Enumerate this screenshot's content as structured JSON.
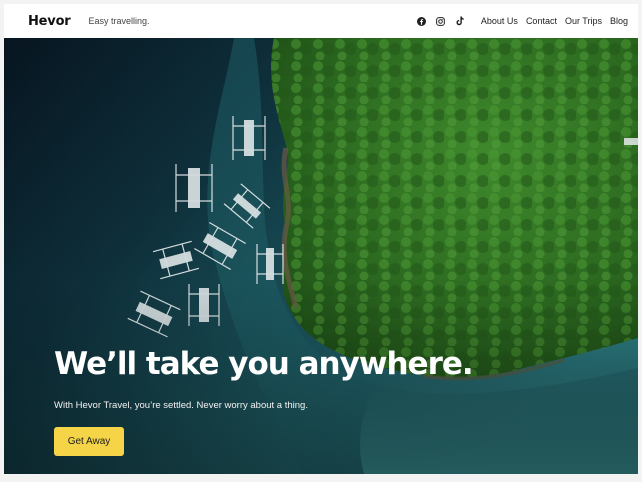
{
  "header": {
    "logo": "Hevor",
    "tagline": "Easy travelling.",
    "socials": [
      {
        "icon": "facebook-icon"
      },
      {
        "icon": "instagram-icon"
      },
      {
        "icon": "tiktok-icon"
      }
    ],
    "nav": [
      "About Us",
      "Contact",
      "Our Trips",
      "Blog"
    ]
  },
  "hero": {
    "title": "We’ll take you anywhere.",
    "subtitle": "With Hevor Travel, you’re settled. Never worry about a thing.",
    "cta_label": "Get Away"
  },
  "colors": {
    "accent": "#f5d547",
    "text_dark": "#111111",
    "sea_deep": "#0b2230",
    "sea_shallow": "#2f7f86",
    "forest": "#2e6a22"
  }
}
